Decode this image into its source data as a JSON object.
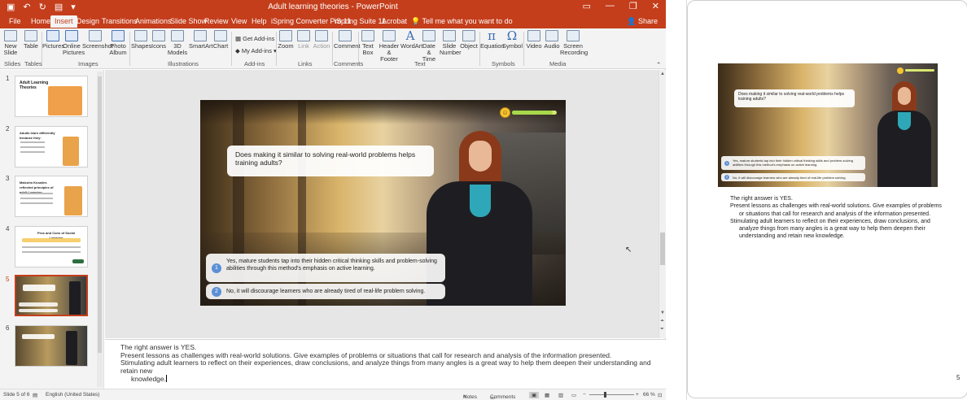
{
  "window": {
    "title": "Adult learning theories - PowerPoint",
    "share_label": "Share",
    "tell_me": "Tell me what you want to do"
  },
  "tabs": [
    {
      "label": "File"
    },
    {
      "label": "Home"
    },
    {
      "label": "Insert",
      "active": true
    },
    {
      "label": "Design"
    },
    {
      "label": "Transitions"
    },
    {
      "label": "Animations"
    },
    {
      "label": "Slide Show"
    },
    {
      "label": "Review"
    },
    {
      "label": "View"
    },
    {
      "label": "Help"
    },
    {
      "label": "iSpring Converter Pro 11"
    },
    {
      "label": "iSpring Suite 11"
    },
    {
      "label": "Acrobat"
    }
  ],
  "ribbon": {
    "buttons": {
      "new_slide": "New Slide",
      "table": "Table",
      "pictures": "Pictures",
      "online_pictures": "Online Pictures",
      "screenshot": "Screenshot",
      "photo_album": "Photo Album",
      "shapes": "Shapes",
      "icons": "Icons",
      "models_3d": "3D Models",
      "smartart": "SmartArt",
      "chart": "Chart",
      "get_addins": "Get Add-ins",
      "my_addins": "My Add-ins",
      "zoom": "Zoom",
      "link": "Link",
      "action": "Action",
      "comment": "Comment",
      "text_box": "Text Box",
      "header_footer": "Header & Footer",
      "wordart": "WordArt",
      "date_time": "Date & Time",
      "slide_number": "Slide Number",
      "object": "Object",
      "equation": "Equation",
      "symbol": "Symbol",
      "video": "Video",
      "audio": "Audio",
      "screen_recording": "Screen Recording"
    },
    "groups": {
      "slides": "Slides",
      "tables": "Tables",
      "images": "Images",
      "illustrations": "Illustrations",
      "addins": "Add-ins",
      "links": "Links",
      "comments": "Comments",
      "text": "Text",
      "symbols": "Symbols",
      "media": "Media"
    }
  },
  "thumbnails": {
    "numbers": [
      "1",
      "2",
      "3",
      "4",
      "5",
      "6"
    ],
    "selected": "5",
    "slide1_title": "Adult Learning Theories",
    "slide2_title": "Adults learn differently because they:",
    "slide3_title": "Malcolm Knowles reflected principles of adult Learning",
    "slide4_title": "Pros and Cons of Social Learning"
  },
  "slide": {
    "question": "Does making it similar to solving real-world problems helps training adults?",
    "answers": [
      {
        "num": "1",
        "text": "Yes, mature students tap into their hidden critical thinking skills and problem-solving abilities through this method's emphasis on active learning."
      },
      {
        "num": "2",
        "text": "No, it will discourage learners who are already tired of real-life problem solving."
      }
    ],
    "meter_level": 0.9
  },
  "notes": {
    "line1": "The right answer is YES.",
    "line2": "Present lessons as challenges with real-world solutions. Give examples of problems or situations that call for research and analysis of the information presented.",
    "line3a": "Stimulating adult learners to reflect on their experiences, draw conclusions, and analyze things from many angles is a great way to help them deepen their understanding and retain new",
    "line3b": "knowledge."
  },
  "notes_page": {
    "line1": "The right answer is YES.",
    "line2": "Present lessons  as challenges with real-world solutions.  Give examples of problems or situations  that call for research and analysis of the information presented.",
    "line3": "Stimulating adult learners to reflect on their experiences, draw conclusions,  and analyze things from many angles is a great way to help them deepen their understanding and retain new knowledge.",
    "page_number": "5"
  },
  "status": {
    "slide_of": "Slide 5 of 6",
    "language": "English (United States)",
    "notes": "Notes",
    "comments": "Comments",
    "zoom": "66 %"
  },
  "colors": {
    "accent": "#c43e1c",
    "answer_badge": "#5b8fd6"
  }
}
